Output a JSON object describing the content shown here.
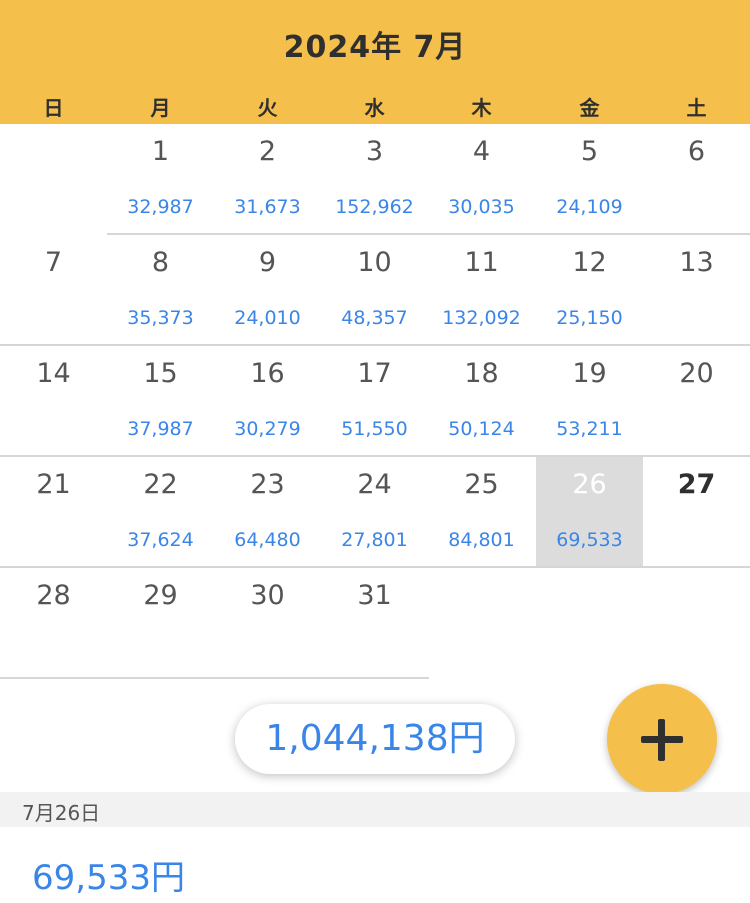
{
  "header": {
    "title": "2024年 7月"
  },
  "weekdays": [
    "日",
    "月",
    "火",
    "水",
    "木",
    "金",
    "土"
  ],
  "weeks": [
    [
      {
        "day": "",
        "amount": ""
      },
      {
        "day": "1",
        "amount": "32,987"
      },
      {
        "day": "2",
        "amount": "31,673"
      },
      {
        "day": "3",
        "amount": "152,962"
      },
      {
        "day": "4",
        "amount": "30,035"
      },
      {
        "day": "5",
        "amount": "24,109"
      },
      {
        "day": "6",
        "amount": ""
      }
    ],
    [
      {
        "day": "7",
        "amount": ""
      },
      {
        "day": "8",
        "amount": "35,373"
      },
      {
        "day": "9",
        "amount": "24,010"
      },
      {
        "day": "10",
        "amount": "48,357"
      },
      {
        "day": "11",
        "amount": "132,092"
      },
      {
        "day": "12",
        "amount": "25,150"
      },
      {
        "day": "13",
        "amount": ""
      }
    ],
    [
      {
        "day": "14",
        "amount": ""
      },
      {
        "day": "15",
        "amount": "37,987"
      },
      {
        "day": "16",
        "amount": "30,279"
      },
      {
        "day": "17",
        "amount": "51,550"
      },
      {
        "day": "18",
        "amount": "50,124"
      },
      {
        "day": "19",
        "amount": "53,211"
      },
      {
        "day": "20",
        "amount": ""
      }
    ],
    [
      {
        "day": "21",
        "amount": ""
      },
      {
        "day": "22",
        "amount": "37,624"
      },
      {
        "day": "23",
        "amount": "64,480"
      },
      {
        "day": "24",
        "amount": "27,801"
      },
      {
        "day": "25",
        "amount": "84,801"
      },
      {
        "day": "26",
        "amount": "69,533",
        "selected": true
      },
      {
        "day": "27",
        "amount": "",
        "today": true
      }
    ],
    [
      {
        "day": "28",
        "amount": ""
      },
      {
        "day": "29",
        "amount": ""
      },
      {
        "day": "30",
        "amount": ""
      },
      {
        "day": "31",
        "amount": ""
      },
      {
        "day": "",
        "amount": ""
      },
      {
        "day": "",
        "amount": ""
      },
      {
        "day": "",
        "amount": ""
      }
    ]
  ],
  "total": {
    "label": "1,044,138円"
  },
  "fab": {
    "icon": "plus-icon"
  },
  "selected_date": {
    "label": "7月26日"
  },
  "detail": {
    "amount": "69,533円"
  },
  "colors": {
    "accent": "#f4bf4a",
    "amount": "#3a86e8",
    "selected_bg": "#dcdcdc"
  }
}
